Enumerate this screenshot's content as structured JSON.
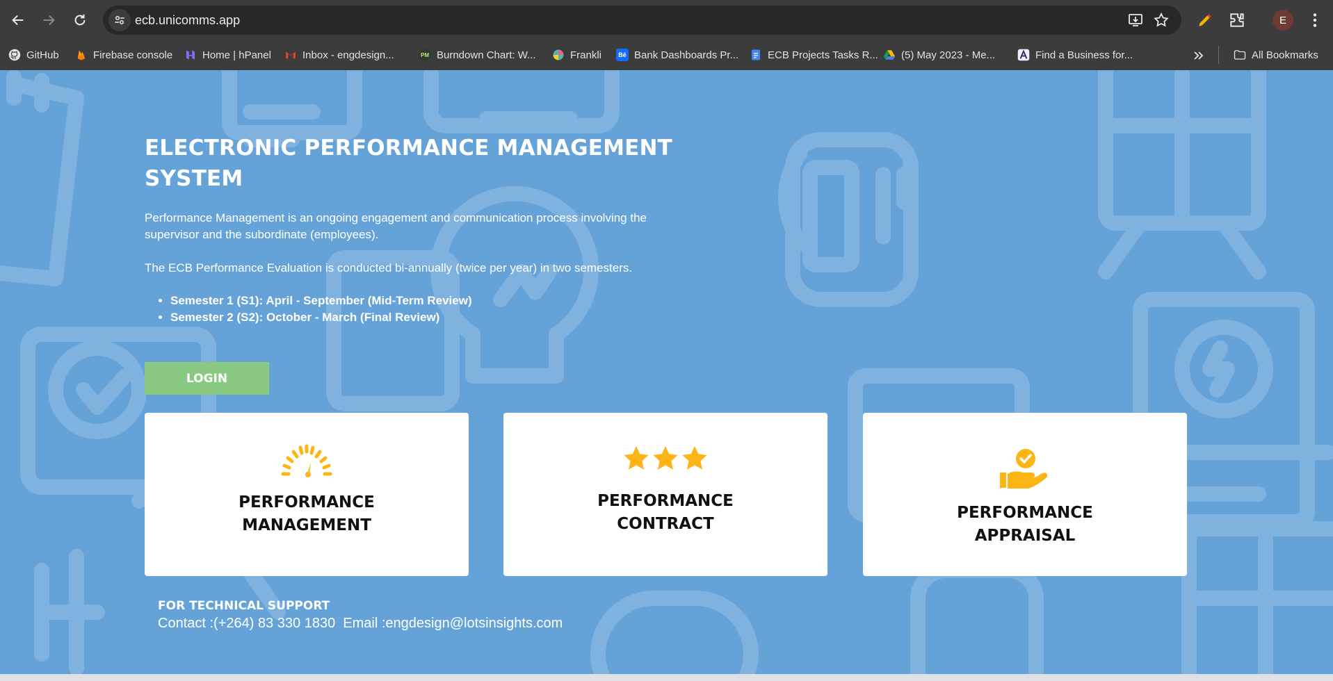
{
  "browser": {
    "url": "ecb.unicomms.app",
    "avatar_letter": "E",
    "bookmarks": [
      {
        "label": "GitHub",
        "icon": "github-icon",
        "color": "#24292e"
      },
      {
        "label": "Firebase console",
        "icon": "firebase-icon",
        "color": "#ff9800"
      },
      {
        "label": "Home | hPanel",
        "icon": "hostinger-icon",
        "color": "#673de6"
      },
      {
        "label": "Inbox - engdesign...",
        "icon": "gmail-icon",
        "color": "#ea4335"
      },
      {
        "label": "Burndown Chart: W...",
        "icon": "pm-icon",
        "color": "#2f3b2f",
        "badge": "PM"
      },
      {
        "label": "Frankli",
        "icon": "frankli-icon",
        "color": "#f06292"
      },
      {
        "label": "Bank Dashboards Pr...",
        "icon": "behance-icon",
        "color": "#1769ff",
        "badge": "Bē"
      },
      {
        "label": "ECB Projects Tasks R...",
        "icon": "google-docs-icon",
        "color": "#4285f4"
      },
      {
        "label": "(5) May 2023 - Me...",
        "icon": "google-drive-icon",
        "color": "#0f9d58"
      },
      {
        "label": "Find a Business for...",
        "icon": "business-icon",
        "color": "#1a2b5a"
      }
    ],
    "all_bookmarks": "All Bookmarks"
  },
  "hero": {
    "title": "ELECTRONIC PERFORMANCE MANAGEMENT SYSTEM",
    "intro": "Performance Management is an ongoing engagement and communication process involving the supervisor and the subordinate (employees).",
    "evaluation": "The ECB Performance Evaluation is conducted bi-annually (twice per year) in two semesters.",
    "semesters": [
      "Semester 1 (S1): April - September (Mid-Term Review)",
      "Semester 2 (S2): October - March (Final Review)"
    ],
    "login_label": "LOGIN"
  },
  "cards": [
    {
      "title": "PERFORMANCE MANAGEMENT",
      "icon": "speedometer-icon"
    },
    {
      "title": "PERFORMANCE CONTRACT",
      "icon": "three-stars-icon"
    },
    {
      "title": "PERFORMANCE APPRAISAL",
      "icon": "hand-check-icon"
    }
  ],
  "support": {
    "heading": "FOR TECHNICAL SUPPORT",
    "contact_line": "Contact :(+264) 83 330 1830  Email :engdesign@lotsinsights.com"
  },
  "colors": {
    "page_bg": "#65a2d8",
    "login_button": "#89c981",
    "icon_accent": "#fdb515",
    "card_bg": "#ffffff"
  }
}
